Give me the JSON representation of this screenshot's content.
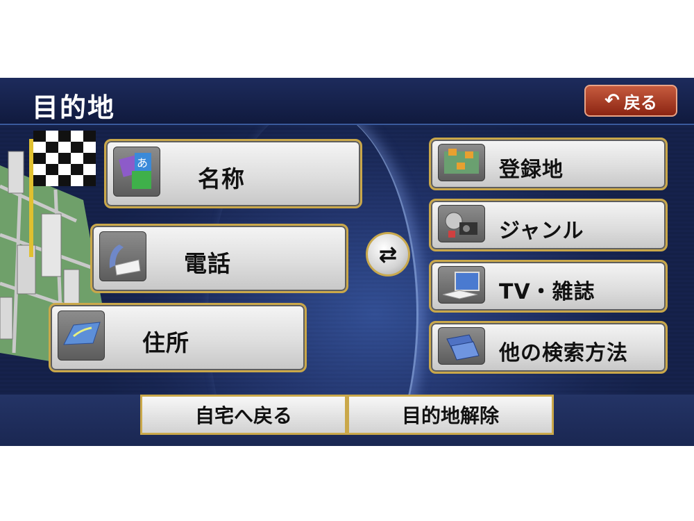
{
  "header": {
    "title": "目的地",
    "back_label": "戻る",
    "back_icon": "return-arrow-icon"
  },
  "left_menu": [
    {
      "label": "名称",
      "icon": "kana-search-icon"
    },
    {
      "label": "電話",
      "icon": "phone-icon"
    },
    {
      "label": "住所",
      "icon": "map-icon"
    }
  ],
  "right_menu": [
    {
      "label": "登録地",
      "icon": "registered-places-icon"
    },
    {
      "label": "ジャンル",
      "icon": "genre-icon"
    },
    {
      "label": "TV・雑誌",
      "icon": "tv-magazine-icon"
    },
    {
      "label": "他の検索方法",
      "icon": "other-search-icon"
    }
  ],
  "swap_icon": "swap-arrows-icon",
  "bottom": {
    "home_label": "自宅へ戻る",
    "cancel_label": "目的地解除"
  },
  "colors": {
    "frame": "#caa84a",
    "back_button": "#b04a2e",
    "background": "#1a2a5e"
  }
}
